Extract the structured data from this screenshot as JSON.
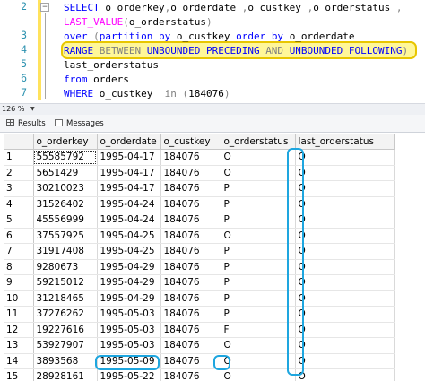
{
  "editor": {
    "line_numbers": [
      "2",
      "3",
      "4",
      "5",
      "6",
      "7"
    ],
    "lines": [
      [
        {
          "t": "SELECT ",
          "c": "kw"
        },
        {
          "t": "o_orderkey",
          "c": ""
        },
        {
          "t": ",",
          "c": "gr"
        },
        {
          "t": "o_orderdate ",
          "c": ""
        },
        {
          "t": ",",
          "c": "gr"
        },
        {
          "t": "o_custkey ",
          "c": ""
        },
        {
          "t": ",",
          "c": "gr"
        },
        {
          "t": "o_orderstatus ",
          "c": ""
        },
        {
          "t": ",",
          "c": "gr"
        }
      ],
      [
        {
          "t": "LAST_VALUE",
          "c": "fn"
        },
        {
          "t": "(",
          "c": "gr"
        },
        {
          "t": "o_orderstatus",
          "c": ""
        },
        {
          "t": ")",
          "c": "gr"
        }
      ],
      [
        {
          "t": "over ",
          "c": "kw"
        },
        {
          "t": "(",
          "c": "gr"
        },
        {
          "t": "partition by ",
          "c": "kw"
        },
        {
          "t": "o_custkey ",
          "c": ""
        },
        {
          "t": "order by ",
          "c": "kw"
        },
        {
          "t": "o_orderdate",
          "c": ""
        }
      ],
      [
        {
          "t": "RANGE ",
          "c": "kw"
        },
        {
          "t": "BETWEEN ",
          "c": "gr"
        },
        {
          "t": "UNBOUNDED PRECEDING ",
          "c": "kw"
        },
        {
          "t": "AND ",
          "c": "gr"
        },
        {
          "t": "UNBOUNDED FOLLOWING",
          "c": "kw"
        },
        {
          "t": ")",
          "c": "gr"
        }
      ],
      [
        {
          "t": "last_orderstatus",
          "c": ""
        }
      ],
      [
        {
          "t": "from ",
          "c": "kw"
        },
        {
          "t": "orders",
          "c": ""
        }
      ],
      [
        {
          "t": "WHERE ",
          "c": "kw"
        },
        {
          "t": "o_custkey  ",
          "c": ""
        },
        {
          "t": "in ",
          "c": "gr"
        },
        {
          "t": "(",
          "c": "gr"
        },
        {
          "t": "184076",
          "c": ""
        },
        {
          "t": ")",
          "c": "gr"
        }
      ]
    ],
    "fold_symbol": "−"
  },
  "status": {
    "zoom": "126 %",
    "zoom_caret": "▼"
  },
  "tabs": {
    "results": "Results",
    "messages": "Messages"
  },
  "grid": {
    "columns": [
      "o_orderkey",
      "o_orderdate",
      "o_custkey",
      "o_orderstatus",
      "last_orderstatus"
    ],
    "rows": [
      [
        "1",
        "55585792",
        "1995-04-17",
        "184076",
        "O",
        "O"
      ],
      [
        "2",
        "5651429",
        "1995-04-17",
        "184076",
        "O",
        "O"
      ],
      [
        "3",
        "30210023",
        "1995-04-17",
        "184076",
        "P",
        "O"
      ],
      [
        "4",
        "31526402",
        "1995-04-24",
        "184076",
        "P",
        "O"
      ],
      [
        "5",
        "45556999",
        "1995-04-24",
        "184076",
        "P",
        "O"
      ],
      [
        "6",
        "37557925",
        "1995-04-25",
        "184076",
        "O",
        "O"
      ],
      [
        "7",
        "31917408",
        "1995-04-25",
        "184076",
        "P",
        "O"
      ],
      [
        "8",
        "9280673",
        "1995-04-29",
        "184076",
        "P",
        "O"
      ],
      [
        "9",
        "59215012",
        "1995-04-29",
        "184076",
        "P",
        "O"
      ],
      [
        "10",
        "31218465",
        "1995-04-29",
        "184076",
        "P",
        "O"
      ],
      [
        "11",
        "37276262",
        "1995-05-03",
        "184076",
        "P",
        "O"
      ],
      [
        "12",
        "19227616",
        "1995-05-03",
        "184076",
        "F",
        "O"
      ],
      [
        "13",
        "53927907",
        "1995-05-03",
        "184076",
        "O",
        "O"
      ],
      [
        "14",
        "3893568",
        "1995-05-09",
        "184076",
        "O",
        "O"
      ],
      [
        "15",
        "28928161",
        "1995-05-22",
        "184076",
        "O",
        "O"
      ]
    ]
  },
  "colors": {
    "highlight_border": "#e8c600",
    "highlight_fill": "#fff799",
    "callout": "#1ea6df",
    "keyword": "#0000ff",
    "function": "#ff00ff",
    "line_number": "#2b91af"
  }
}
